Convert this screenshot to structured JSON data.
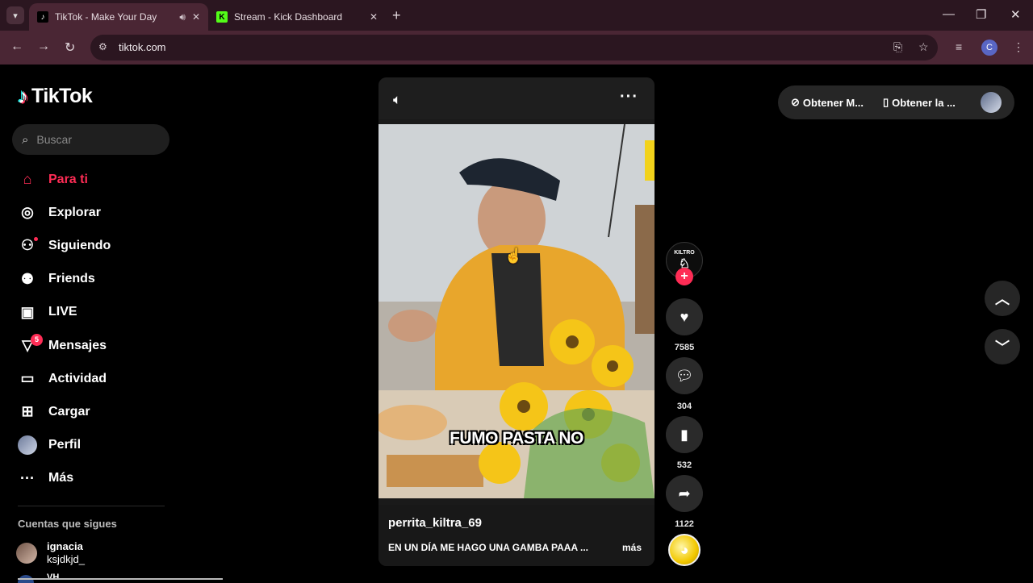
{
  "browser": {
    "tabs": [
      {
        "title": "TikTok - Make Your Day",
        "favicon": "tiktok-favicon",
        "active": true
      },
      {
        "title": "Stream - Kick Dashboard",
        "favicon": "kick-favicon",
        "active": false
      }
    ],
    "url": "tiktok.com",
    "profile_initial": "C"
  },
  "sidebar": {
    "logo": "TikTok",
    "search_placeholder": "Buscar",
    "nav": [
      {
        "label": "Para ti",
        "icon": "home-icon",
        "active": true
      },
      {
        "label": "Explorar",
        "icon": "compass-icon"
      },
      {
        "label": "Siguiendo",
        "icon": "following-icon"
      },
      {
        "label": "Friends",
        "icon": "friends-icon"
      },
      {
        "label": "LIVE",
        "icon": "live-icon"
      },
      {
        "label": "Mensajes",
        "icon": "messages-icon",
        "badge": "5"
      },
      {
        "label": "Actividad",
        "icon": "activity-icon"
      },
      {
        "label": "Cargar",
        "icon": "upload-icon"
      },
      {
        "label": "Perfil",
        "icon": "profile-avatar"
      },
      {
        "label": "Más",
        "icon": "more-icon"
      }
    ],
    "following_title": "Cuentas que sigues",
    "following": [
      {
        "name": "ignacia",
        "handle": "ksjdkjd_"
      },
      {
        "name": "VH"
      }
    ]
  },
  "video": {
    "username": "perrita_kiltra_69",
    "description": "EN UN DÍA ME HAGO UNA GAMBA PAAA ...",
    "more_label": "más",
    "subtitle": "FUMO PASTA NO",
    "creator_badge": "KILTRO"
  },
  "actions": {
    "likes": "7585",
    "comments": "304",
    "saves": "532",
    "shares": "1122"
  },
  "header_right": {
    "get_app_1": "Obtener M...",
    "get_app_2": "Obtener la ..."
  }
}
